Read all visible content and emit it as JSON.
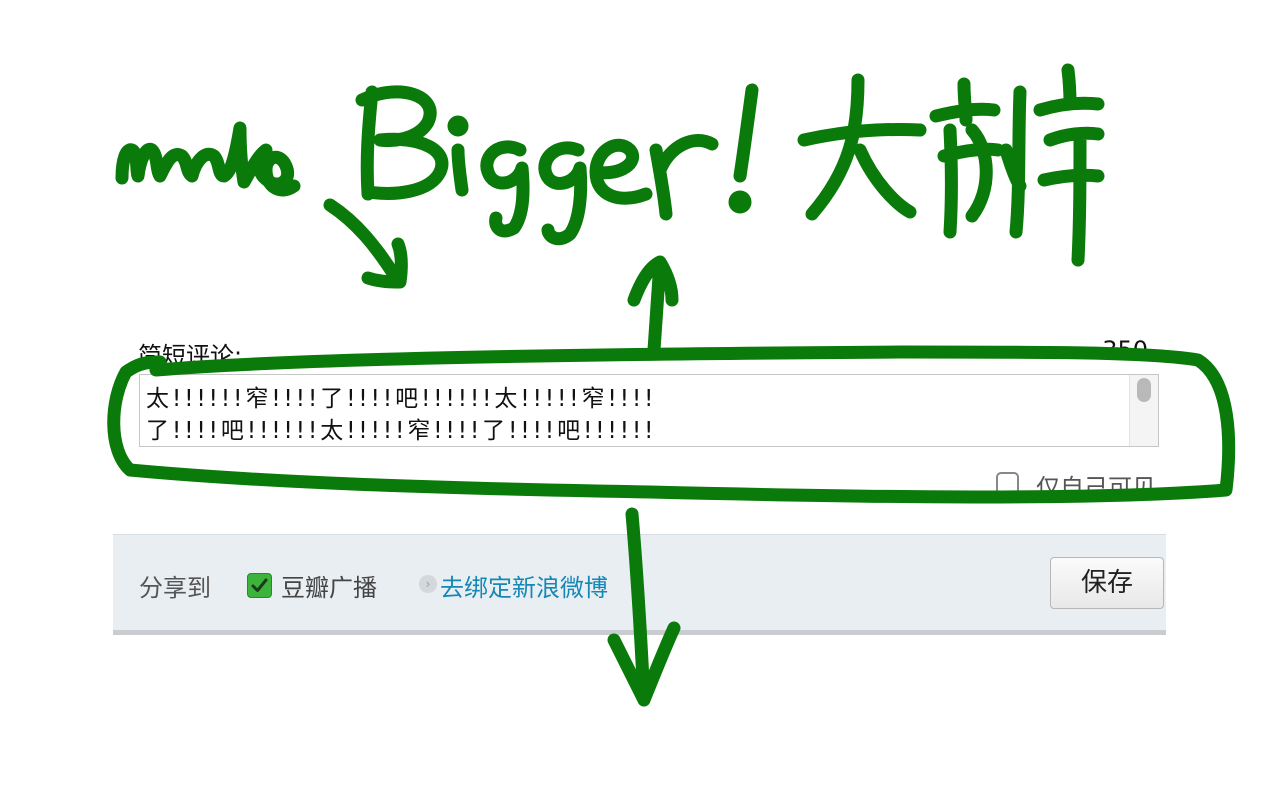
{
  "comment": {
    "label": "简短评论:",
    "char_count": "350",
    "textarea_lines": "太!!!!!!窄!!!!了!!!!吧!!!!!!太!!!!!窄!!!!\n了!!!!吧!!!!!!太!!!!!窄!!!!了!!!!吧!!!!!!",
    "private_label": "仅自己可见",
    "private_checked": false
  },
  "share": {
    "label": "分享到",
    "douban_label": "豆瓣广播",
    "douban_checked": true,
    "bind_link": "去绑定新浪微博",
    "save_label": "保存"
  },
  "annotation": {
    "text": "make Bigger! 大瓣",
    "color": "#0a7a0a"
  },
  "colors": {
    "link": "#1588b5",
    "checkbox_green": "#3cb43c",
    "share_bar_bg": "#e9eef2"
  }
}
